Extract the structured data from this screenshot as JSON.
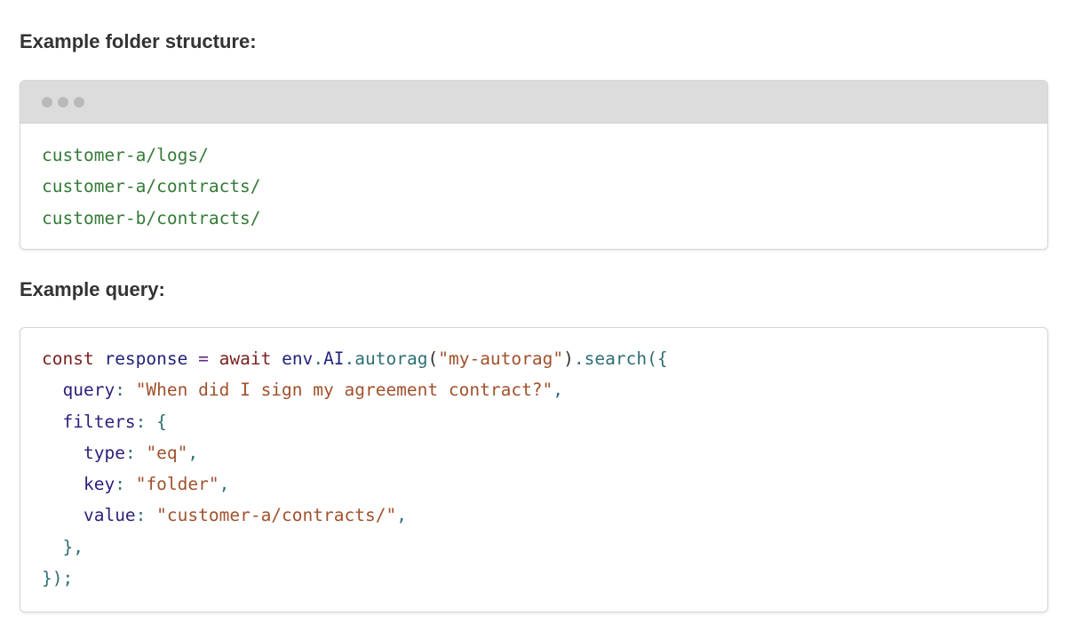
{
  "headings": {
    "folder_structure": "Example folder structure:",
    "query": "Example query:"
  },
  "folder_block": {
    "lines": [
      "customer-a/logs/",
      "customer-a/contracts/",
      "customer-b/contracts/"
    ]
  },
  "query_block": {
    "tokens": {
      "const": "const",
      "response": "response",
      "eq": "=",
      "await": "await",
      "env": "env",
      "dot1": ".",
      "AI": "AI",
      "dot2": ".",
      "autorag": "autorag",
      "paren_open": "(",
      "autorag_arg": "\"my-autorag\"",
      "paren_close": ")",
      "dot3": ".",
      "search": "search",
      "open_call": "({",
      "query_key": "query",
      "colon1": ":",
      "query_val": "\"When did I sign my agreement contract?\"",
      "comma1": ",",
      "filters_key": "filters",
      "colon2": ":",
      "brace_open": "{",
      "type_key": "type",
      "colon3": ":",
      "type_val": "\"eq\"",
      "comma2": ",",
      "key_key": "key",
      "colon4": ":",
      "key_val": "\"folder\"",
      "comma3": ",",
      "value_key": "value",
      "colon5": ":",
      "value_val": "\"customer-a/contracts/\"",
      "comma4": ",",
      "brace_close": "},",
      "end": "});"
    }
  },
  "colors": {
    "path_green": "#357a38",
    "keyword": "#7a1f1f",
    "string": "#a0522d",
    "property": "#2d1f7a",
    "titlebar": "#dcdcdc"
  }
}
